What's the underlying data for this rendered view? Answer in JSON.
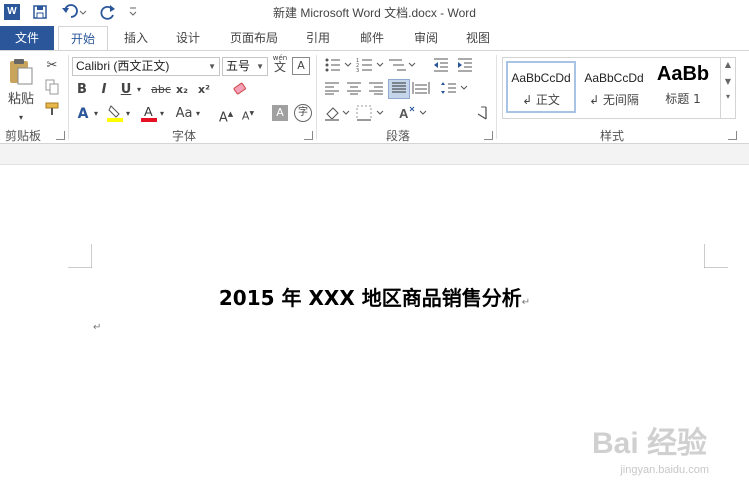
{
  "window": {
    "title": "新建 Microsoft Word 文档.docx - Word",
    "app_icon_letter": "W"
  },
  "qat": {
    "save_icon": "save-icon",
    "undo_icon": "undo-icon",
    "redo_icon": "redo-icon",
    "customize_icon": "customize-qat-icon"
  },
  "tabs": [
    {
      "label": "文件"
    },
    {
      "label": "开始"
    },
    {
      "label": "插入"
    },
    {
      "label": "设计"
    },
    {
      "label": "页面布局"
    },
    {
      "label": "引用"
    },
    {
      "label": "邮件"
    },
    {
      "label": "审阅"
    },
    {
      "label": "视图"
    }
  ],
  "ribbon": {
    "clipboard": {
      "label": "剪贴板",
      "paste_label": "粘贴"
    },
    "font": {
      "label": "字体",
      "font_name": "Calibri (西文正文)",
      "font_size": "五号",
      "wen_label": "wén",
      "wen_char": "文",
      "bold": "B",
      "italic": "I",
      "underline": "U",
      "strike": "abc",
      "subscript": "x₂",
      "superscript": "x²",
      "change_case": "Aa",
      "char_shading": "A",
      "enclose_char": "字"
    },
    "paragraph": {
      "label": "段落"
    },
    "styles": {
      "label": "样式",
      "items": [
        {
          "preview": "AaBbCcDd",
          "name": "↲ 正文"
        },
        {
          "preview": "AaBbCcDd",
          "name": "↲ 无间隔"
        },
        {
          "preview": "AaBb",
          "name": "标题 1"
        }
      ]
    }
  },
  "document": {
    "title": "2015 年 XXX 地区商品销售分析",
    "para_mark": "↵"
  },
  "watermark": {
    "text": "Bai 经验",
    "url": "jingyan.baidu.com"
  },
  "colors": {
    "accent": "#2b579a",
    "highlight_yellow": "#ffff00",
    "font_red": "#e81123"
  }
}
